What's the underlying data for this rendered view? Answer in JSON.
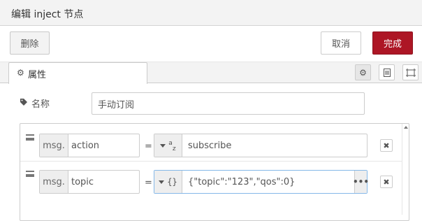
{
  "header": {
    "title": "编辑 inject 节点"
  },
  "toolbar": {
    "delete_label": "删除",
    "cancel_label": "取消",
    "done_label": "完成"
  },
  "tabs": {
    "properties_label": "属性"
  },
  "form": {
    "name_label": "名称",
    "name_value": "手动订阅",
    "props": [
      {
        "prefix": "msg.",
        "key": "action",
        "type_symbol": "a_z",
        "value": "subscribe"
      },
      {
        "prefix": "msg.",
        "key": "topic",
        "type_symbol": "{}",
        "value": "{\"topic\":\"123\",\"qos\":0}"
      }
    ],
    "eq": "="
  },
  "colors": {
    "accent": "#ad1625",
    "border": "#cccccc",
    "bg_header": "#f3f3f3"
  }
}
